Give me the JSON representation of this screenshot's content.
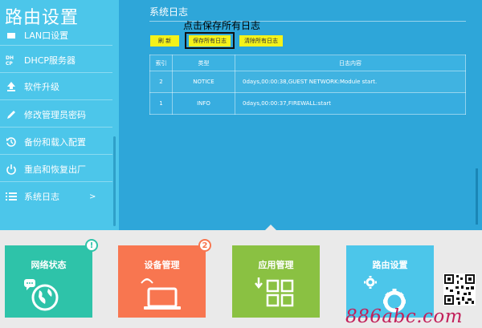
{
  "header": {
    "title": "路由设置"
  },
  "sidebar": {
    "items": [
      {
        "label": "LAN口设置",
        "icon": "lan-icon"
      },
      {
        "label": "DHCP服务器",
        "icon": "dhcp-icon"
      },
      {
        "label": "软件升级",
        "icon": "upgrade-icon"
      },
      {
        "label": "修改管理员密码",
        "icon": "pencil-icon"
      },
      {
        "label": "备份和载入配置",
        "icon": "backup-icon"
      },
      {
        "label": "重启和恢复出厂",
        "icon": "power-icon"
      },
      {
        "label": "系统日志",
        "icon": "list-icon",
        "arrow": ">"
      }
    ]
  },
  "main": {
    "title": "系统日志",
    "annotation": "点击保存所有日志",
    "buttons": {
      "refresh": "刷 新",
      "save": "保存所有日志",
      "clear": "清除所有日志"
    },
    "table": {
      "headers": [
        "索引",
        "类型",
        "日志内容"
      ],
      "rows": [
        {
          "index": "2",
          "type": "NOTICE",
          "content": "0days,00:00:38,GUEST NETWORK:Module start."
        },
        {
          "index": "1",
          "type": "INFO",
          "content": "0days,00:00:37,FIREWALL:start"
        }
      ]
    }
  },
  "tiles": [
    {
      "label": "网络状态",
      "badge": "!",
      "color": "#2ec3a9",
      "icon": "globe-icon"
    },
    {
      "label": "设备管理",
      "badge": "2",
      "color": "#f87650",
      "icon": "laptop-icon"
    },
    {
      "label": "应用管理",
      "badge": "",
      "color": "#8ac142",
      "icon": "apps-icon"
    },
    {
      "label": "路由设置",
      "badge": "",
      "color": "#4cc6ea",
      "icon": "gear-icon"
    }
  ],
  "qr": {
    "caption": "QR code"
  },
  "watermark": "886abc.com",
  "colors": {
    "sidebar": "#4cc6ea",
    "main": "#2ea6d9",
    "button": "#f4f21a"
  }
}
